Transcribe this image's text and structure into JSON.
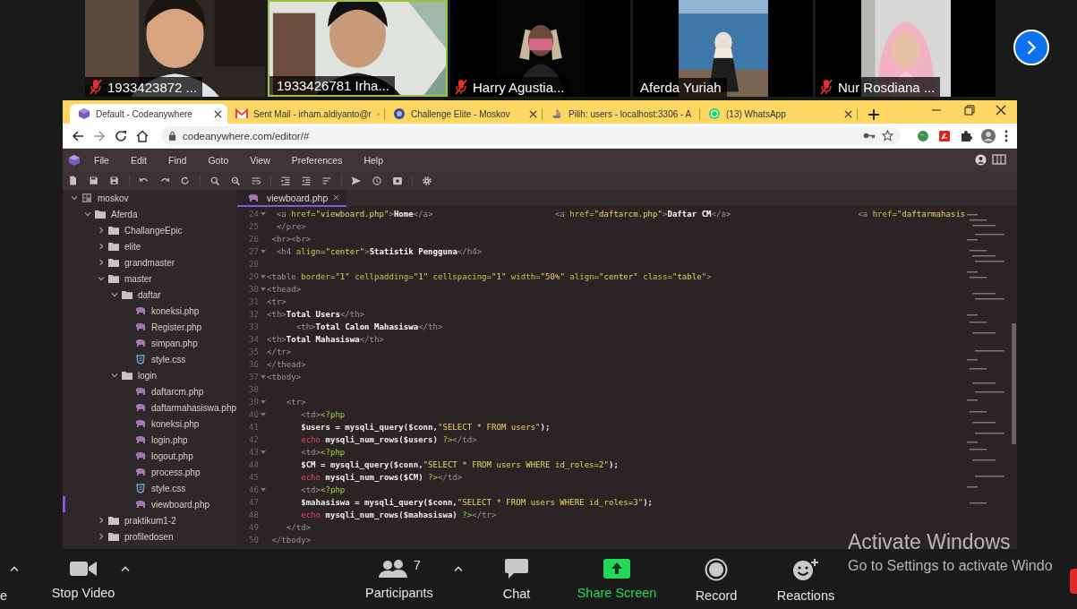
{
  "participants": [
    {
      "name": "1933423872 ...",
      "muted": true,
      "active_speaker": false,
      "kind": "wide"
    },
    {
      "name": "1933426781 Irha...",
      "muted": false,
      "active_speaker": true,
      "kind": "wide"
    },
    {
      "name": "Harry Agustia...",
      "muted": true,
      "active_speaker": false,
      "kind": "narrow"
    },
    {
      "name": "Aferda Yuriah",
      "muted": false,
      "active_speaker": false,
      "kind": "narrow"
    },
    {
      "name": "Nur Rosdiana ...",
      "muted": true,
      "active_speaker": false,
      "kind": "narrow"
    }
  ],
  "browser": {
    "tabs": [
      {
        "title": "Default - Codeanywhere",
        "kind": "codeanywhere",
        "selected": true
      },
      {
        "title": "Sent Mail - irham.aldiyanto@r",
        "kind": "gmail",
        "selected": false
      },
      {
        "title": "Challenge Elite - Moskov",
        "kind": "moskov",
        "selected": false
      },
      {
        "title": "Pilih: users - localhost:3306 - A",
        "kind": "database",
        "selected": false
      },
      {
        "title": "(13) WhatsApp",
        "kind": "whatsapp",
        "selected": false
      }
    ],
    "url": "codeanywhere.com/editor/#"
  },
  "editor": {
    "menu": [
      "File",
      "Edit",
      "Find",
      "Goto",
      "View",
      "Preferences",
      "Help"
    ],
    "open_tab": {
      "title": "viewboard.php",
      "selected": true
    },
    "tree": [
      {
        "name": "moskov",
        "kind": "project",
        "expanded": true,
        "selected": false,
        "children": [
          {
            "name": "Aferda",
            "kind": "folder",
            "expanded": true,
            "selected": false,
            "children": [
              {
                "name": "ChallangeEpic",
                "kind": "folder",
                "expanded": false,
                "selected": false
              },
              {
                "name": "elite",
                "kind": "folder",
                "expanded": false,
                "selected": false
              },
              {
                "name": "grandmaster",
                "kind": "folder",
                "expanded": false,
                "selected": false
              },
              {
                "name": "master",
                "kind": "folder",
                "expanded": true,
                "selected": false,
                "children": [
                  {
                    "name": "daftar",
                    "kind": "folder",
                    "expanded": true,
                    "selected": false,
                    "children": [
                      {
                        "name": "koneksi.php",
                        "kind": "php",
                        "selected": false
                      },
                      {
                        "name": "Register.php",
                        "kind": "php",
                        "selected": false
                      },
                      {
                        "name": "simpan.php",
                        "kind": "php",
                        "selected": false
                      },
                      {
                        "name": "style.css",
                        "kind": "css",
                        "selected": false
                      }
                    ]
                  },
                  {
                    "name": "login",
                    "kind": "folder",
                    "expanded": true,
                    "selected": false,
                    "children": [
                      {
                        "name": "daftarcm.php",
                        "kind": "php",
                        "selected": false
                      },
                      {
                        "name": "daftarmahasiswa.php",
                        "kind": "php",
                        "selected": false
                      },
                      {
                        "name": "koneksi.php",
                        "kind": "php",
                        "selected": false
                      },
                      {
                        "name": "login.php",
                        "kind": "php",
                        "selected": false
                      },
                      {
                        "name": "logout.php",
                        "kind": "php",
                        "selected": false
                      },
                      {
                        "name": "process.php",
                        "kind": "php",
                        "selected": false
                      },
                      {
                        "name": "style.css",
                        "kind": "css",
                        "selected": false
                      },
                      {
                        "name": "viewboard.php",
                        "kind": "php",
                        "selected": true
                      }
                    ]
                  }
                ]
              },
              {
                "name": "praktikum1-2",
                "kind": "folder",
                "expanded": false,
                "selected": false
              },
              {
                "name": "profiledosen",
                "kind": "folder",
                "expanded": false,
                "selected": false
              }
            ]
          }
        ]
      }
    ],
    "lines": [
      {
        "n": "24",
        "fold": true,
        "tokens": [
          {
            "kind": "tag",
            "text": "  <a "
          },
          {
            "kind": "attr",
            "text": "href="
          },
          {
            "kind": "str",
            "text": "\"viewboard.php\""
          },
          {
            "kind": "tag",
            "text": ">"
          },
          {
            "kind": "text",
            "text": "Home"
          },
          {
            "kind": "tag",
            "text": "</a>                         <a "
          },
          {
            "kind": "attr",
            "text": "href="
          },
          {
            "kind": "str",
            "text": "\"daftarcm.php\""
          },
          {
            "kind": "tag",
            "text": ">"
          },
          {
            "kind": "text",
            "text": "Daftar CM"
          },
          {
            "kind": "tag",
            "text": "</a>                          <a "
          },
          {
            "kind": "attr",
            "text": "href="
          },
          {
            "kind": "str",
            "text": "\"daftarmahasis"
          }
        ]
      },
      {
        "n": "25",
        "fold": false,
        "tokens": [
          {
            "kind": "tag",
            "text": "  </pre>"
          }
        ]
      },
      {
        "n": "26",
        "fold": false,
        "tokens": [
          {
            "kind": "tag",
            "text": " <br><br>"
          }
        ]
      },
      {
        "n": "27",
        "fold": true,
        "tokens": [
          {
            "kind": "tag",
            "text": "  <h4 "
          },
          {
            "kind": "attr",
            "text": "align="
          },
          {
            "kind": "str",
            "text": "\"center\""
          },
          {
            "kind": "tag",
            "text": ">"
          },
          {
            "kind": "text",
            "text": "Statistik Pengguna"
          },
          {
            "kind": "tag",
            "text": "</h4>"
          }
        ]
      },
      {
        "n": "28",
        "fold": false
      },
      {
        "n": "29",
        "fold": true,
        "tokens": [
          {
            "kind": "tag",
            "text": "<table "
          },
          {
            "kind": "attr",
            "text": "border="
          },
          {
            "kind": "str",
            "text": "\"1\""
          },
          {
            "kind": "attr",
            "text": " cellpadding="
          },
          {
            "kind": "str",
            "text": "\"1\""
          },
          {
            "kind": "attr",
            "text": " cellspacing="
          },
          {
            "kind": "str",
            "text": "\"1\""
          },
          {
            "kind": "attr",
            "text": " width="
          },
          {
            "kind": "str",
            "text": "\"50%\""
          },
          {
            "kind": "attr",
            "text": " align="
          },
          {
            "kind": "str",
            "text": "\"center\""
          },
          {
            "kind": "attr",
            "text": " class="
          },
          {
            "kind": "str",
            "text": "\"table\""
          },
          {
            "kind": "tag",
            "text": ">"
          }
        ]
      },
      {
        "n": "30",
        "fold": true,
        "tokens": [
          {
            "kind": "tag",
            "text": "<thead>"
          }
        ]
      },
      {
        "n": "31",
        "fold": false,
        "tokens": [
          {
            "kind": "tag",
            "text": "<tr>"
          }
        ]
      },
      {
        "n": "32",
        "fold": false,
        "tokens": [
          {
            "kind": "tag",
            "text": "<th>"
          },
          {
            "kind": "text",
            "text": "Total Users"
          },
          {
            "kind": "tag",
            "text": "</th>"
          }
        ]
      },
      {
        "n": "33",
        "fold": false,
        "tokens": [
          {
            "kind": "tag",
            "text": "      <th>"
          },
          {
            "kind": "text",
            "text": "Total Calon Mahasiswa"
          },
          {
            "kind": "tag",
            "text": "</th>"
          }
        ]
      },
      {
        "n": "34",
        "fold": false,
        "tokens": [
          {
            "kind": "tag",
            "text": "<th>"
          },
          {
            "kind": "text",
            "text": "Total Mahasiswa"
          },
          {
            "kind": "tag",
            "text": "</th>"
          }
        ]
      },
      {
        "n": "35",
        "fold": false,
        "tokens": [
          {
            "kind": "tag",
            "text": "</tr>"
          }
        ]
      },
      {
        "n": "36",
        "fold": false,
        "tokens": [
          {
            "kind": "tag",
            "text": "</thead>"
          }
        ]
      },
      {
        "n": "37",
        "fold": true,
        "tokens": [
          {
            "kind": "tag",
            "text": "<tbody>"
          }
        ]
      },
      {
        "n": "38",
        "fold": false
      },
      {
        "n": "39",
        "fold": true,
        "tokens": [
          {
            "kind": "tag",
            "text": "    <tr>"
          }
        ]
      },
      {
        "n": "40",
        "fold": true,
        "tokens": [
          {
            "kind": "tag",
            "text": "       <td>"
          },
          {
            "kind": "php",
            "text": "<?php"
          }
        ]
      },
      {
        "n": "41",
        "fold": false,
        "tokens": [
          {
            "kind": "code",
            "text": "       $users = mysqli_query($conn,"
          },
          {
            "kind": "str",
            "text": "\"SELECT * FROM users\""
          },
          {
            "kind": "code",
            "text": ");"
          }
        ]
      },
      {
        "n": "42",
        "fold": false,
        "tokens": [
          {
            "kind": "kw",
            "text": "       echo"
          },
          {
            "kind": "code",
            "text": " mysqli_num_rows($users) "
          },
          {
            "kind": "php",
            "text": "?>"
          },
          {
            "kind": "tag",
            "text": "</td>"
          }
        ]
      },
      {
        "n": "43",
        "fold": true,
        "tokens": [
          {
            "kind": "tag",
            "text": "       <td>"
          },
          {
            "kind": "php",
            "text": "<?php"
          }
        ]
      },
      {
        "n": "44",
        "fold": false,
        "tokens": [
          {
            "kind": "code",
            "text": "       $CM = mysqli_query($conn,"
          },
          {
            "kind": "str",
            "text": "\"SELECT * FROM users WHERE id_roles=2\""
          },
          {
            "kind": "code",
            "text": ");"
          }
        ]
      },
      {
        "n": "45",
        "fold": false,
        "tokens": [
          {
            "kind": "kw",
            "text": "       echo"
          },
          {
            "kind": "code",
            "text": " mysqli_num_rows($CM) "
          },
          {
            "kind": "php",
            "text": "?>"
          },
          {
            "kind": "tag",
            "text": "</td>"
          }
        ]
      },
      {
        "n": "46",
        "fold": true,
        "tokens": [
          {
            "kind": "tag",
            "text": "       <td>"
          },
          {
            "kind": "php",
            "text": "<?php"
          }
        ]
      },
      {
        "n": "47",
        "fold": false,
        "tokens": [
          {
            "kind": "code",
            "text": "       $mahasiswa = mysqli_query($conn,"
          },
          {
            "kind": "str",
            "text": "\"SELECT * FROM users WHERE id_roles=3\""
          },
          {
            "kind": "code",
            "text": ");"
          }
        ]
      },
      {
        "n": "48",
        "fold": false,
        "tokens": [
          {
            "kind": "kw",
            "text": "       echo"
          },
          {
            "kind": "code",
            "text": " mysqli_num_rows($mahasiswa) "
          },
          {
            "kind": "php",
            "text": "?>"
          },
          {
            "kind": "tag",
            "text": "</tr>"
          }
        ]
      },
      {
        "n": "49",
        "fold": false,
        "tokens": [
          {
            "kind": "tag",
            "text": "    </td>"
          }
        ]
      },
      {
        "n": "50",
        "fold": false,
        "tokens": [
          {
            "kind": "tag",
            "text": " </tbody>"
          }
        ]
      }
    ]
  },
  "meeting_toolbar": [
    {
      "label": "e",
      "kind": "cut",
      "menu": true
    },
    {
      "label": "Stop Video",
      "kind": "video",
      "menu": true
    },
    {
      "label": "Participants",
      "kind": "participants",
      "count": "7",
      "menu": true
    },
    {
      "label": "Chat",
      "kind": "chat",
      "menu": false
    },
    {
      "label": "Share Screen",
      "kind": "share",
      "menu": false
    },
    {
      "label": "Record",
      "kind": "record",
      "menu": false
    },
    {
      "label": "Reactions",
      "kind": "reactions",
      "menu": false
    }
  ],
  "os_notice": {
    "title": "Activate Windows",
    "text": "Go to Settings to activate Windo"
  }
}
